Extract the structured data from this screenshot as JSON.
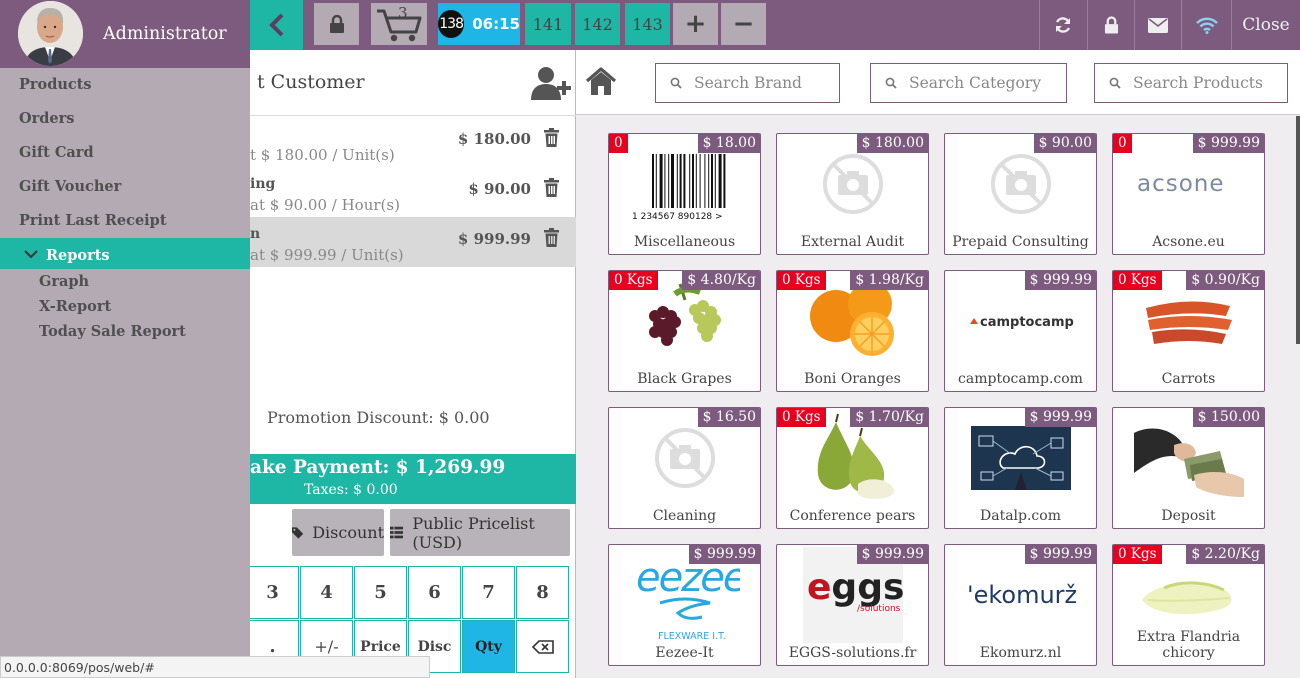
{
  "topbar": {
    "cart_count": "3",
    "orders": [
      {
        "id": "138",
        "time": "06:15",
        "active": true
      },
      {
        "id": "141"
      },
      {
        "id": "142"
      },
      {
        "id": "143"
      }
    ],
    "add_label": "+",
    "remove_label": "−",
    "close_label": "Close"
  },
  "sidebar": {
    "user": "Administrator",
    "items": [
      "Products",
      "Orders",
      "Gift Card",
      "Gift Voucher",
      "Print Last Receipt"
    ],
    "reports_label": "Reports",
    "sub_items": [
      "Graph",
      "X-Report",
      "Today Sale Report"
    ]
  },
  "order": {
    "customer_label": "t Customer",
    "lines": [
      {
        "name": "",
        "price": "$ 180.00",
        "detail": "t $ 180.00 / Unit(s)",
        "selected": false
      },
      {
        "name": "ing",
        "price": "$ 90.00",
        "detail": "at $ 90.00 / Hour(s)",
        "selected": false
      },
      {
        "name": "n",
        "price": "$ 999.99",
        "detail": "at $ 999.99 / Unit(s)",
        "selected": true
      }
    ],
    "promotion": "Promotion Discount: $ 0.00",
    "payment_total": "ake Payment: $ 1,269.99",
    "taxes": "Taxes: $ 0.00",
    "discount_label": "Discount",
    "pricelist_label": "Public Pricelist (USD)"
  },
  "numpad": {
    "row1": [
      "3",
      "4",
      "5",
      "6",
      "7",
      "8"
    ],
    "row2": [
      ".",
      "+/-",
      "Price",
      "Disc",
      "Qty"
    ]
  },
  "search": {
    "brand": "Search Brand",
    "category": "Search Category",
    "products": "Search Products"
  },
  "products": [
    {
      "name": "Miscellaneous",
      "price": "$ 18.00",
      "stock": "0",
      "image": "barcode",
      "barcode_text": "1 234567 890128 >"
    },
    {
      "name": "External Audit",
      "price": "$ 180.00",
      "stock": "",
      "image": "placeholder"
    },
    {
      "name": "Prepaid Consulting",
      "price": "$ 90.00",
      "stock": "",
      "image": "placeholder"
    },
    {
      "name": "Acsone.eu",
      "price": "$ 999.99",
      "stock": "0",
      "image": "acsone",
      "logo_text": "acsone"
    },
    {
      "name": "Black Grapes",
      "price": "$ 4.80/Kg",
      "stock": "0 Kgs",
      "image": "grapes"
    },
    {
      "name": "Boni Oranges",
      "price": "$ 1.98/Kg",
      "stock": "0 Kgs",
      "image": "oranges"
    },
    {
      "name": "camptocamp.com",
      "price": "$ 999.99",
      "stock": "",
      "image": "camptocamp",
      "logo_text": "camptocamp"
    },
    {
      "name": "Carrots",
      "price": "$ 0.90/Kg",
      "stock": "0 Kgs",
      "image": "carrots"
    },
    {
      "name": "Cleaning",
      "price": "$ 16.50",
      "stock": "",
      "image": "placeholder"
    },
    {
      "name": "Conference pears",
      "price": "$ 1.70/Kg",
      "stock": "0 Kgs",
      "image": "pears"
    },
    {
      "name": "Datalp.com",
      "price": "$ 999.99",
      "stock": "",
      "image": "datalp"
    },
    {
      "name": "Deposit",
      "price": "$ 150.00",
      "stock": "",
      "image": "deposit"
    },
    {
      "name": "Eezee-It",
      "price": "$ 999.99",
      "stock": "",
      "image": "eezee",
      "logo_text": "eezee",
      "logo_sub": "FLEXWARE I.T."
    },
    {
      "name": "EGGS-solutions.fr",
      "price": "$ 999.99",
      "stock": "",
      "image": "eggs",
      "logo_text": "eggs",
      "logo_sub": "/solutions"
    },
    {
      "name": "Ekomurz.nl",
      "price": "$ 999.99",
      "stock": "",
      "image": "ekomurz",
      "logo_text": "'ekomurž"
    },
    {
      "name": "Extra Flandria chicory",
      "price": "$ 2.20/Kg",
      "stock": "0 Kgs",
      "image": "chicory"
    }
  ],
  "statusbar": {
    "url": "0.0.0.0:8069/pos/web/#"
  },
  "colors": {
    "brand": "#7c5b7e",
    "accent": "#1eb7a5",
    "active": "#1fb6e6",
    "stock_badge": "#e8001f"
  }
}
